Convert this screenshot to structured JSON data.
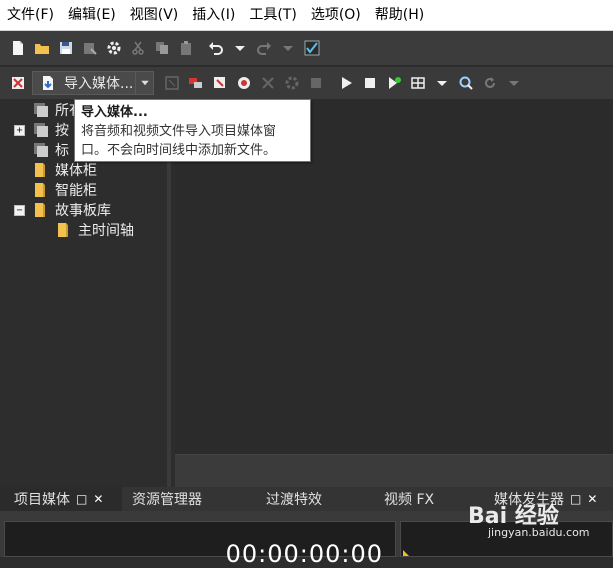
{
  "menubar": {
    "items": [
      {
        "label": "文件(F)"
      },
      {
        "label": "编辑(E)"
      },
      {
        "label": "视图(V)"
      },
      {
        "label": "插入(I)"
      },
      {
        "label": "工具(T)"
      },
      {
        "label": "选项(O)"
      },
      {
        "label": "帮助(H)"
      }
    ]
  },
  "toolbar2": {
    "import_label": "导入媒体..."
  },
  "tooltip": {
    "title": "导入媒体...",
    "body_line1": "将音频和视频文件导入项目媒体窗",
    "body_line2": "口。不会向时间线中添加新文件。"
  },
  "tree": {
    "items": [
      {
        "label": "所有"
      },
      {
        "label": "按"
      },
      {
        "label": "标"
      },
      {
        "label": "媒体柜"
      },
      {
        "label": "智能柜"
      },
      {
        "label": "故事板库"
      },
      {
        "label": "主时间轴"
      }
    ]
  },
  "tabs": [
    {
      "label": "项目媒体"
    },
    {
      "label": "资源管理器"
    },
    {
      "label": "过渡特效"
    },
    {
      "label": "视频 FX"
    },
    {
      "label": "媒体发生器"
    }
  ],
  "preview": {
    "timecode": "00:00:00:00"
  },
  "watermark": {
    "brand": "Bai 经验",
    "url": "jingyan.baidu.com"
  },
  "colors": {
    "background": "#2d2d2d",
    "folder": "#f2c14e",
    "tooltip_bg": "#ffffff"
  }
}
